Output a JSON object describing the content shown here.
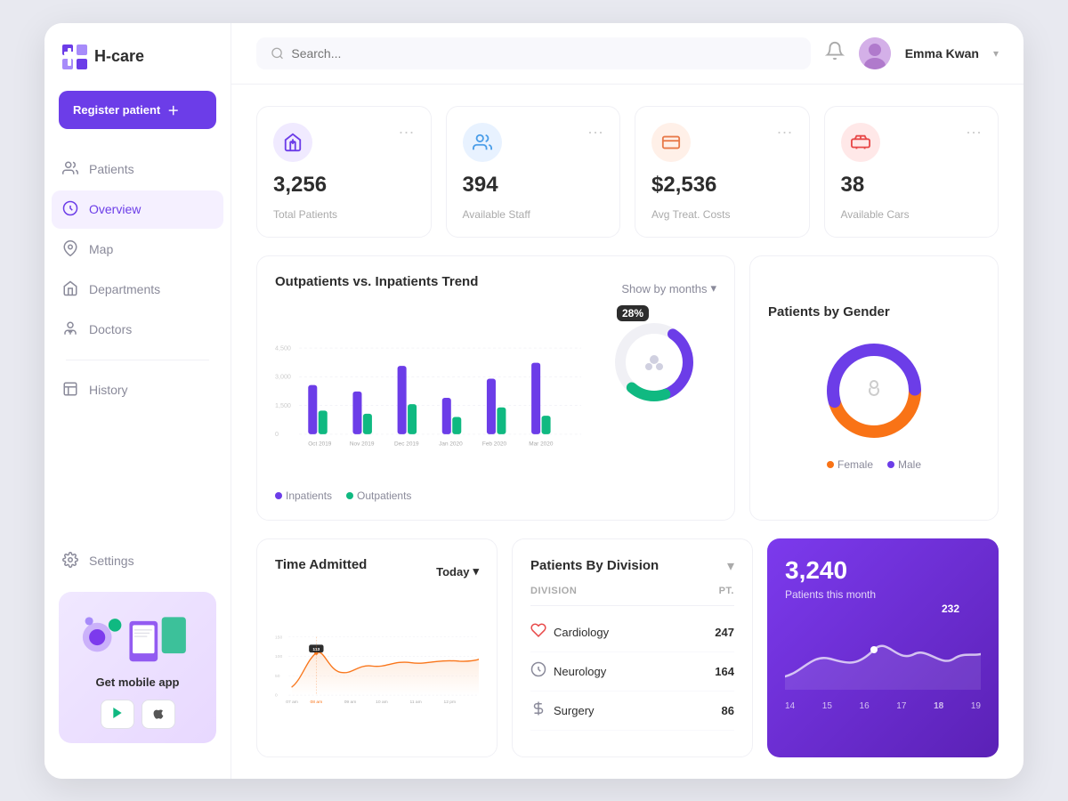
{
  "app": {
    "name": "H-care",
    "logo_symbol": "H+"
  },
  "header": {
    "search_placeholder": "Search...",
    "user_name": "Emma Kwan",
    "bell_icon": "🔔"
  },
  "sidebar": {
    "register_btn": "Register patient",
    "nav_items": [
      {
        "label": "Patients",
        "icon": "👤",
        "active": false
      },
      {
        "label": "Overview",
        "icon": "📊",
        "active": true
      },
      {
        "label": "Map",
        "icon": "📍",
        "active": false
      },
      {
        "label": "Departments",
        "icon": "🏥",
        "active": false
      },
      {
        "label": "Doctors",
        "icon": "👨‍⚕️",
        "active": false
      },
      {
        "label": "History",
        "icon": "📋",
        "active": false
      }
    ],
    "settings_label": "Settings",
    "mobile_app_label": "Get mobile app",
    "google_play": "▶",
    "app_store": "🍎"
  },
  "stats": [
    {
      "value": "3,256",
      "label": "Total Patients",
      "icon": "🛏️",
      "color": "purple"
    },
    {
      "value": "394",
      "label": "Available Staff",
      "icon": "👥",
      "color": "blue"
    },
    {
      "value": "$2,536",
      "label": "Avg Treat. Costs",
      "icon": "💊",
      "color": "orange"
    },
    {
      "value": "38",
      "label": "Available Cars",
      "icon": "🚑",
      "color": "red"
    }
  ],
  "trend_chart": {
    "title": "Outpatients vs. Inpatients Trend",
    "show_by": "Show by months",
    "legend": [
      "Inpatients",
      "Outpatients"
    ],
    "months": [
      "Oct 2019",
      "Nov 2019",
      "Dec 2019",
      "Jan 2020",
      "Feb 2020",
      "Mar 2020"
    ],
    "y_labels": [
      "4,500",
      "3,000",
      "1,500",
      "0"
    ],
    "donut_percent": "28%"
  },
  "gender_chart": {
    "title": "Patients by Gender",
    "female_label": "Female",
    "male_label": "Male",
    "female_pct": 45,
    "male_pct": 55
  },
  "time_admitted": {
    "title": "Time Admitted",
    "filter": "Today",
    "peak_label": "113",
    "peak_time": "08 am",
    "x_labels": [
      "07 am",
      "08 am",
      "09 am",
      "10 am",
      "11 am",
      "12 pm"
    ],
    "y_labels": [
      "150",
      "100",
      "50",
      "0"
    ]
  },
  "patients_by_division": {
    "title": "Patients By Division",
    "filter": "▾",
    "col_division": "DIVISION",
    "col_pt": "PT.",
    "rows": [
      {
        "name": "Cardiology",
        "icon": "❤️",
        "value": "247"
      },
      {
        "name": "Neurology",
        "icon": "🧠",
        "value": "164"
      },
      {
        "name": "Surgery",
        "icon": "✂️",
        "value": "86"
      }
    ]
  },
  "monthly_card": {
    "value": "3,240",
    "label": "Patients this month",
    "highlight_label": "232",
    "x_labels": [
      "14",
      "15",
      "16",
      "17",
      "18",
      "19"
    ]
  }
}
